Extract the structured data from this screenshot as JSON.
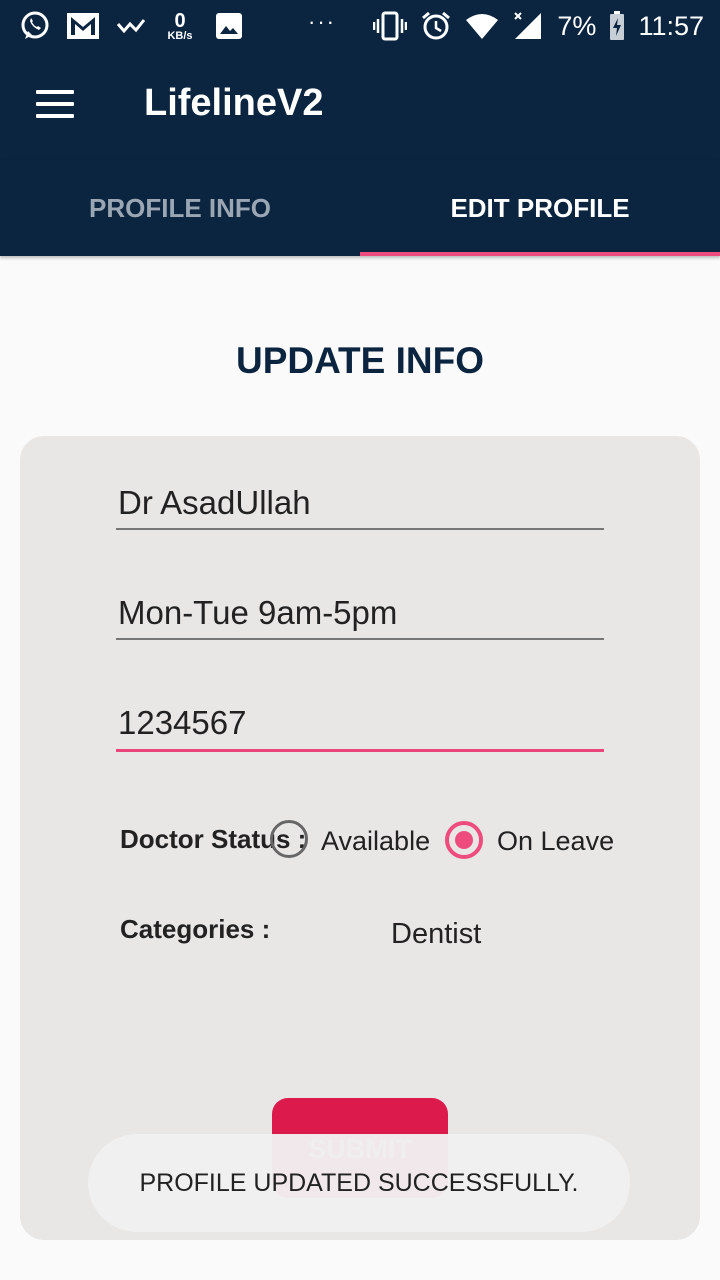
{
  "status_bar": {
    "kb_value": "0",
    "kb_unit": "KB/s",
    "dots": "···",
    "battery": "7%",
    "time": "11:57",
    "icons": [
      "whatsapp-icon",
      "gmail-icon",
      "check-icon",
      "image-icon",
      "vibrate-icon",
      "alarm-icon",
      "wifi-icon",
      "signal-icon",
      "battery-charging-icon"
    ]
  },
  "app_bar": {
    "title": "LifelineV2"
  },
  "tabs": [
    {
      "label": "PROFILE INFO",
      "active": false
    },
    {
      "label": "EDIT PROFILE",
      "active": true
    }
  ],
  "form": {
    "heading": "UPDATE INFO",
    "name_value": "Dr AsadUllah",
    "schedule_value": "Mon-Tue 9am-5pm",
    "phone_value": "1234567",
    "status_label": "Doctor Status :",
    "status_options": [
      {
        "label": "Available",
        "selected": false
      },
      {
        "label": "On Leave",
        "selected": true
      }
    ],
    "categories_label": "Categories :",
    "categories_value": "Dentist",
    "submit_label": "SUBMIT"
  },
  "toast": {
    "message": "PROFILE UPDATED SUCCESSFULLY."
  },
  "colors": {
    "primary": "#0b2540",
    "accent": "#ee4c7e",
    "button": "#dc1b4c",
    "card": "#e8e7e6",
    "background": "#fafafa"
  }
}
